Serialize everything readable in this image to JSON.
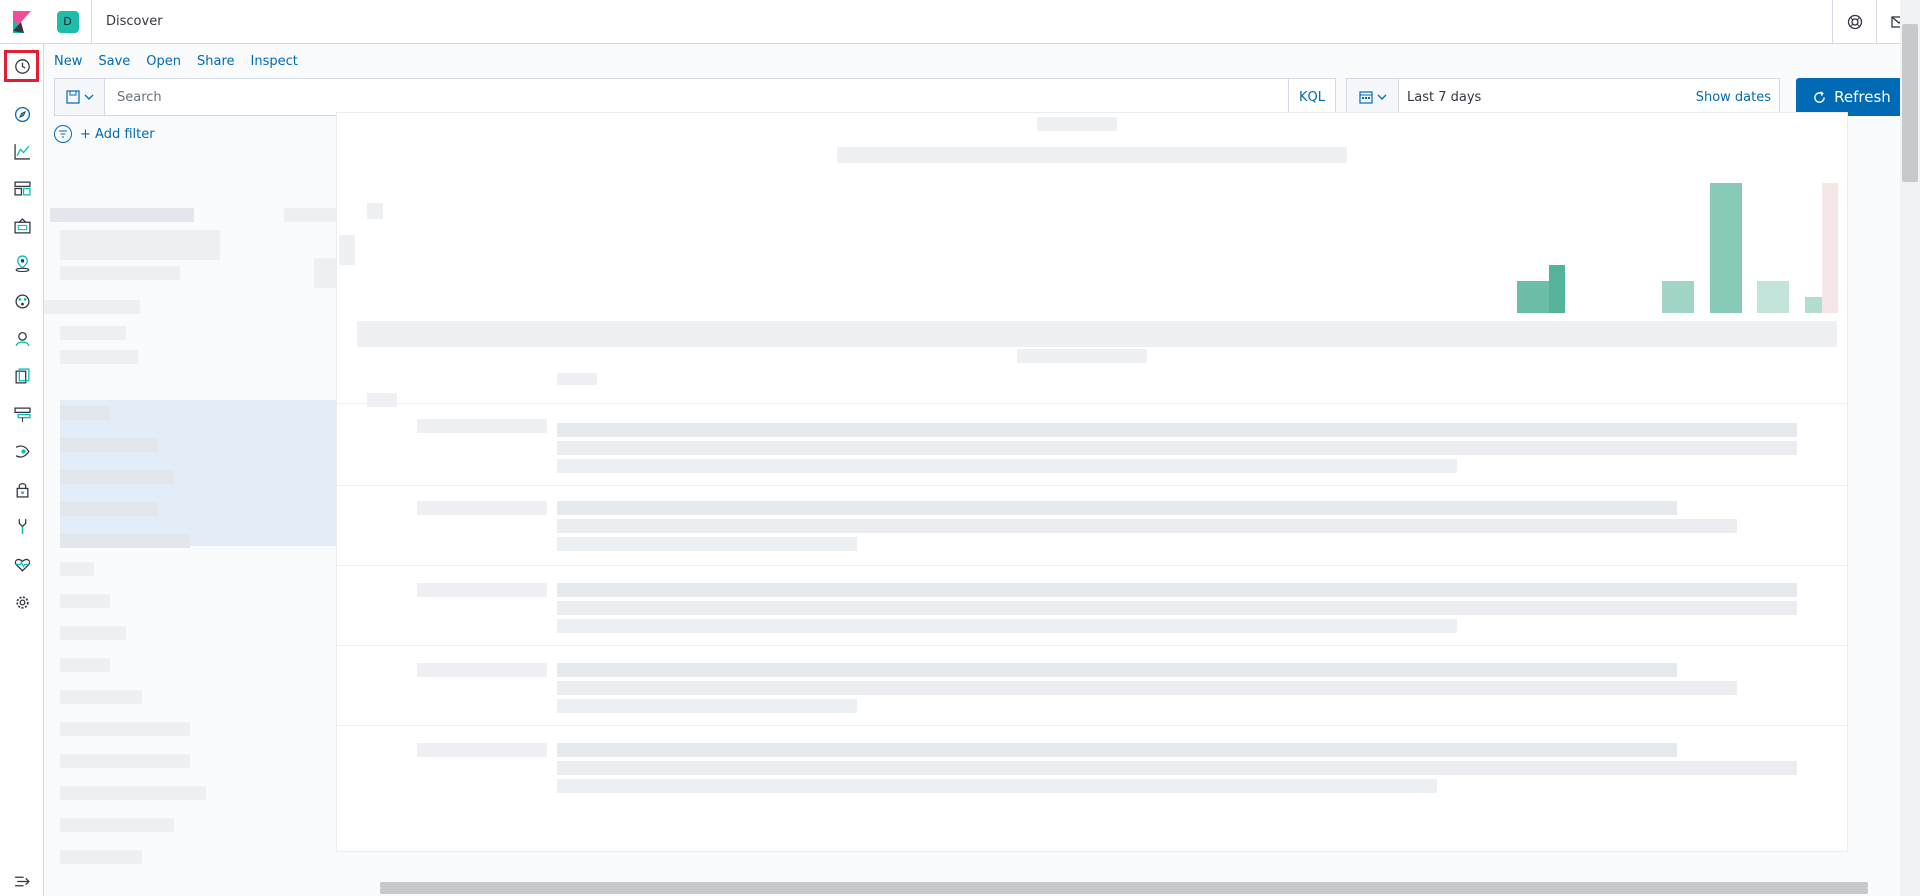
{
  "header": {
    "space_initial": "D",
    "app_title": "Discover"
  },
  "menu": {
    "new": "New",
    "save": "Save",
    "open": "Open",
    "share": "Share",
    "inspect": "Inspect"
  },
  "query": {
    "placeholder": "Search",
    "language": "KQL"
  },
  "time": {
    "range": "Last 7 days",
    "show_dates": "Show dates",
    "refresh": "Refresh"
  },
  "filter": {
    "add_filter": "+ Add filter"
  },
  "colors": {
    "accent": "#006bb4",
    "histogram": "#54b399",
    "highlight": "#e02030"
  },
  "nav_icons": [
    "clock-icon",
    "compass-icon",
    "visualize-icon",
    "dashboard-icon",
    "canvas-icon",
    "maps-icon",
    "ml-icon",
    "graph-icon",
    "logs-icon",
    "infra-icon",
    "apm-icon",
    "siem-icon",
    "devtools-icon",
    "monitoring-icon",
    "management-icon"
  ]
}
